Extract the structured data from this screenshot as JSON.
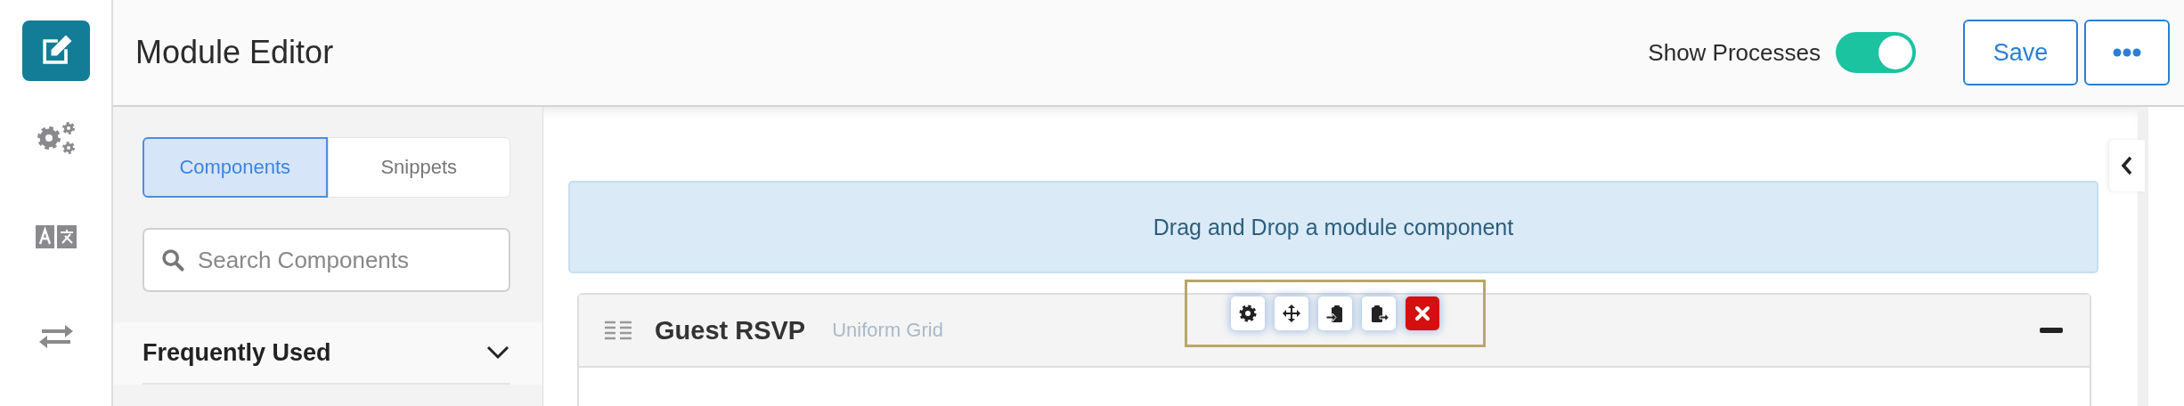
{
  "sidebar": {
    "items": [
      {
        "kind": "edit",
        "selected": true
      },
      {
        "kind": "settings",
        "selected": false
      },
      {
        "kind": "translate",
        "selected": false
      },
      {
        "kind": "transfer",
        "selected": false
      }
    ]
  },
  "header": {
    "title": "Module Editor",
    "toggle": {
      "label": "Show Processes",
      "on": true
    },
    "buttons": [
      {
        "kind": "save",
        "label": "Save"
      },
      {
        "kind": "more"
      }
    ]
  },
  "panel": {
    "tabs": [
      {
        "label": "Components",
        "selected": true
      },
      {
        "label": "Snippets",
        "selected": false
      }
    ],
    "search": {
      "placeholder": "Search Components"
    },
    "sections": [
      {
        "title": "Frequently Used",
        "expanded": false
      }
    ]
  },
  "canvas": {
    "dropzone": "Drag and Drop a module component",
    "modules": [
      {
        "title": "Guest RSVP",
        "type": "Uniform Grid",
        "collapsed": false,
        "toolbar": [
          {
            "kind": "settings"
          },
          {
            "kind": "move"
          },
          {
            "kind": "paste-in"
          },
          {
            "kind": "copy-out"
          },
          {
            "kind": "delete"
          }
        ]
      }
    ]
  }
}
